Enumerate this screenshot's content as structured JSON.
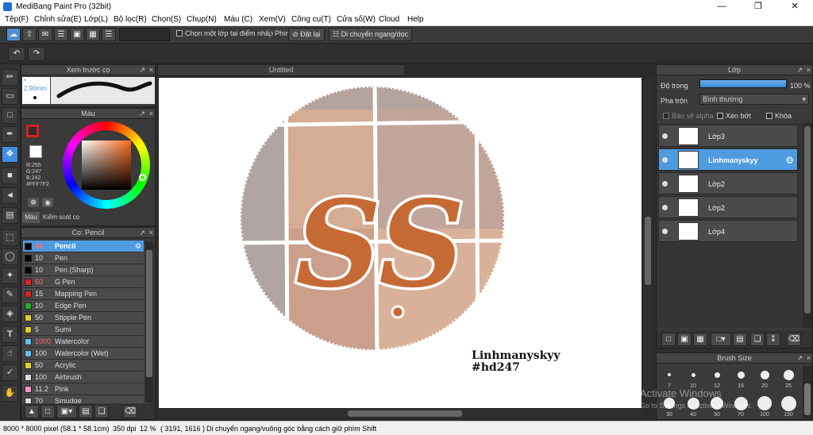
{
  "window": {
    "title": "MediBang Paint Pro (32bit)"
  },
  "menu": [
    "Tệp(F)",
    "Chỉnh sửa(E)",
    "Lớp(L)",
    "Bộ lọc(R)",
    "Chọn(S)",
    "Chụp(N)",
    "Màu (C)",
    "Xem(V)",
    "Công cụ(T)",
    "Cửa số(W)",
    "Cloud",
    "Help"
  ],
  "toolbar": {
    "select_from_point_label": "Chọn một lớp tại điểm nhấp",
    "snap_label": "Phím",
    "reset_label": "Đặt lại",
    "move_label": "Di chuyển ngang/dọc"
  },
  "brush_preview": {
    "title": "Xem trước cọ",
    "size": "2.90mm"
  },
  "color_panel": {
    "title": "Màu",
    "r": "R:255",
    "g": "G:247",
    "b": "B:242",
    "hex": "#FFF7F2",
    "primary": "#d42020",
    "secondary": "#ffffff",
    "tab_color": "Màu",
    "tab_brush_control": "Kiểm soát cọ"
  },
  "brush_panel": {
    "title": "Cọ: Pencil",
    "items": [
      {
        "size": "40",
        "name": "Pencil",
        "color": "#000000",
        "selected": true
      },
      {
        "size": "10",
        "name": "Pen",
        "color": "#000000"
      },
      {
        "size": "10",
        "name": "Pen (Sharp)",
        "color": "#000000"
      },
      {
        "size": "50",
        "name": "G Pen",
        "color": "#e02020"
      },
      {
        "size": "15",
        "name": "Mapping Pen",
        "color": "#e02020"
      },
      {
        "size": "10",
        "name": "Edge Pen",
        "color": "#20b020"
      },
      {
        "size": "50",
        "name": "Stipple Pen",
        "color": "#e0d020"
      },
      {
        "size": "5",
        "name": "Sumi",
        "color": "#e0d020"
      },
      {
        "size": "1000",
        "name": "Watercolor",
        "color": "#60c0f0"
      },
      {
        "size": "100",
        "name": "Watercolor (Wet)",
        "color": "#60c0f0"
      },
      {
        "size": "50",
        "name": "Acrylic",
        "color": "#e0d020"
      },
      {
        "size": "100",
        "name": "Airbrush",
        "color": "#dddddd"
      },
      {
        "size": "11.2",
        "name": "Pink",
        "color": "#ff90d0"
      },
      {
        "size": "70",
        "name": "Smudge",
        "color": "#dddddd"
      }
    ]
  },
  "document": {
    "tab": "Untitled",
    "artwork_text": "SS",
    "signature_line1": "Linhmanyskyy",
    "signature_line2": "#hd247"
  },
  "layers_panel": {
    "title": "Lớp",
    "opacity_label": "Độ trong",
    "opacity_value": "100 %",
    "opacity_fraction": 1.0,
    "blend_label": "Pha trộn",
    "blend_value": "Bình thường",
    "protect_alpha": "Bảo vệ alpha",
    "clipping": "Xén bớt",
    "lock": "Khóa",
    "layers": [
      {
        "name": "Lớp3",
        "selected": false
      },
      {
        "name": "Linhmanyskyy",
        "selected": true
      },
      {
        "name": "Lớp2",
        "selected": false
      },
      {
        "name": "Lớp2",
        "selected": false
      },
      {
        "name": "Lớp4",
        "selected": false
      }
    ]
  },
  "brush_size_panel": {
    "title": "Brush Size",
    "sizes": [
      "7",
      "10",
      "12",
      "15",
      "20",
      "25",
      "30",
      "40",
      "50",
      "70",
      "100",
      "150"
    ]
  },
  "status_bar": {
    "size": "8000 * 8000 pixel",
    "dimensions": "(58.1 * 58.1cm)",
    "dpi": "350 dpi",
    "zoom": "12 %",
    "coords": "( 3191, 1616 )",
    "hint": "Di chuyển ngang/vuông góc bằng cách giữ phím Shift"
  },
  "watermark": {
    "line1": "Activate Windows",
    "line2": "Go to Settings to activate Windows."
  }
}
